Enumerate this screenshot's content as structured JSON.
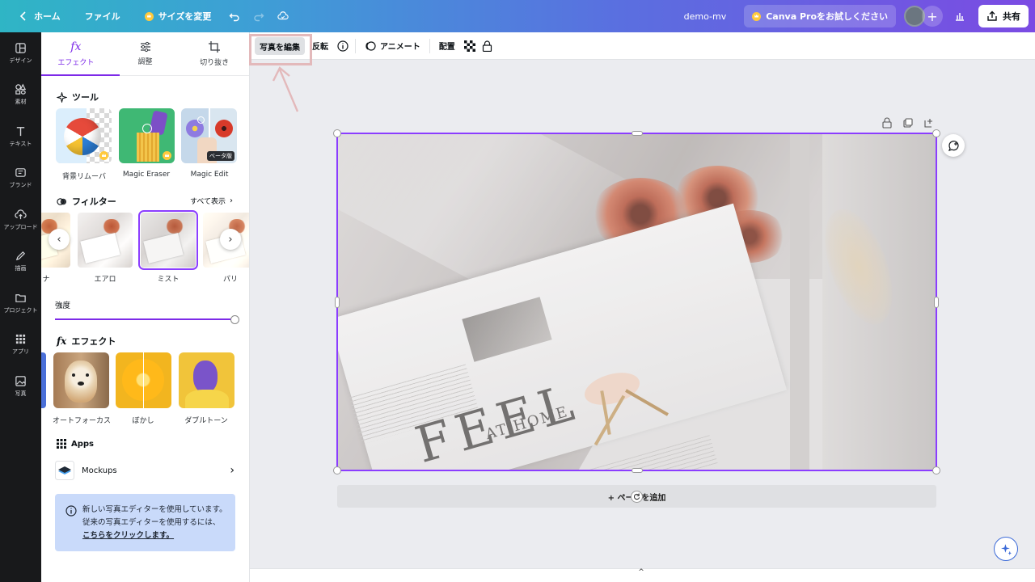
{
  "topbar": {
    "home": "ホーム",
    "file": "ファイル",
    "resize": "サイズを変更",
    "doc_title": "demo-mv",
    "pro": "Canva Proをお試しください",
    "share": "共有"
  },
  "rail": {
    "items": [
      {
        "label": "デザイン"
      },
      {
        "label": "素材"
      },
      {
        "label": "テキスト"
      },
      {
        "label": "ブランド"
      },
      {
        "label": "アップロード"
      },
      {
        "label": "描画"
      },
      {
        "label": "プロジェクト"
      },
      {
        "label": "アプリ"
      },
      {
        "label": "写真"
      }
    ]
  },
  "panel": {
    "tabs": [
      {
        "label": "エフェクト",
        "icon": "fx"
      },
      {
        "label": "調整",
        "icon": "sliders"
      },
      {
        "label": "切り抜き",
        "icon": "crop"
      }
    ],
    "tools_title": "ツール",
    "tools": [
      {
        "label": "背景リムーバ"
      },
      {
        "label": "Magic Eraser"
      },
      {
        "label": "Magic Edit",
        "badge": "ベータ版"
      }
    ],
    "filters_title": "フィルター",
    "filters_see_all": "すべて表示",
    "filters": [
      {
        "label": "ナ"
      },
      {
        "label": "エアロ"
      },
      {
        "label": "ミスト"
      },
      {
        "label": "パリ"
      }
    ],
    "strength_label": "強度",
    "strength_value": 1.0,
    "effects_title": "エフェクト",
    "effects": [
      {
        "label": "オートフォーカス"
      },
      {
        "label": "ぼかし"
      },
      {
        "label": "ダブルトーン"
      }
    ],
    "apps_title": "Apps",
    "mockups": "Mockups",
    "info_text": "新しい写真エディターを使用しています。従来の写真エディターを使用するには、",
    "info_link": "こちらをクリックします。"
  },
  "toolbar": {
    "edit_photo": "写真を編集",
    "flip": "反転",
    "animate": "アニメート",
    "position": "配置"
  },
  "canvas": {
    "add_page": "+ ページを追加",
    "photo_text_main": "FEEL",
    "photo_text_sub": "AT HOME"
  },
  "colors": {
    "accent": "#7d2ae8",
    "selection": "#8b3dff",
    "highlight": "#e3b9bb"
  }
}
